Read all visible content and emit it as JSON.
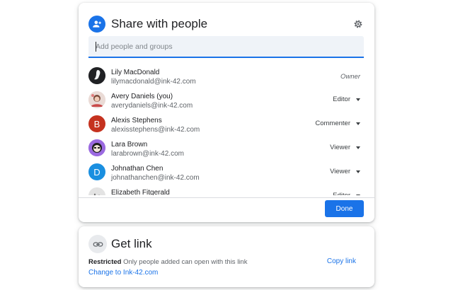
{
  "share": {
    "title": "Share with people",
    "add_placeholder": "Add people and groups",
    "done_label": "Done",
    "people": [
      {
        "name": "Lily MacDonald",
        "email": "lilymacdonald@ink-42.com",
        "role": "Owner",
        "avatar_letter": "",
        "avatar_color": "#202124"
      },
      {
        "name": "Avery Daniels (you)",
        "email": "averydaniels@ink-42.com",
        "role": "Editor",
        "avatar_letter": "",
        "avatar_color": "#e8d3cf"
      },
      {
        "name": "Alexis Stephens",
        "email": "alexisstephens@ink-42.com",
        "role": "Commenter",
        "avatar_letter": "B",
        "avatar_color": "#c5321f"
      },
      {
        "name": "Lara Brown",
        "email": "larabrown@ink-42.com",
        "role": "Viewer",
        "avatar_letter": "",
        "avatar_color": "#8e5bd6"
      },
      {
        "name": "Johnathan Chen",
        "email": "johnathanchen@ink-42.com",
        "role": "Viewer",
        "avatar_letter": "D",
        "avatar_color": "#1a8fe0"
      },
      {
        "name": "Elizabeth Fitgerald",
        "email": "",
        "role": "Editor",
        "avatar_letter": "",
        "avatar_color": "#d9d9d9"
      }
    ]
  },
  "get_link": {
    "title": "Get link",
    "restricted_label": "Restricted",
    "restricted_text": "Only people added can open with this link",
    "change_label": "Change to Ink-42.com",
    "copy_label": "Copy link"
  },
  "colors": {
    "accent": "#1a73e8",
    "field_bg": "#eff3f8"
  }
}
